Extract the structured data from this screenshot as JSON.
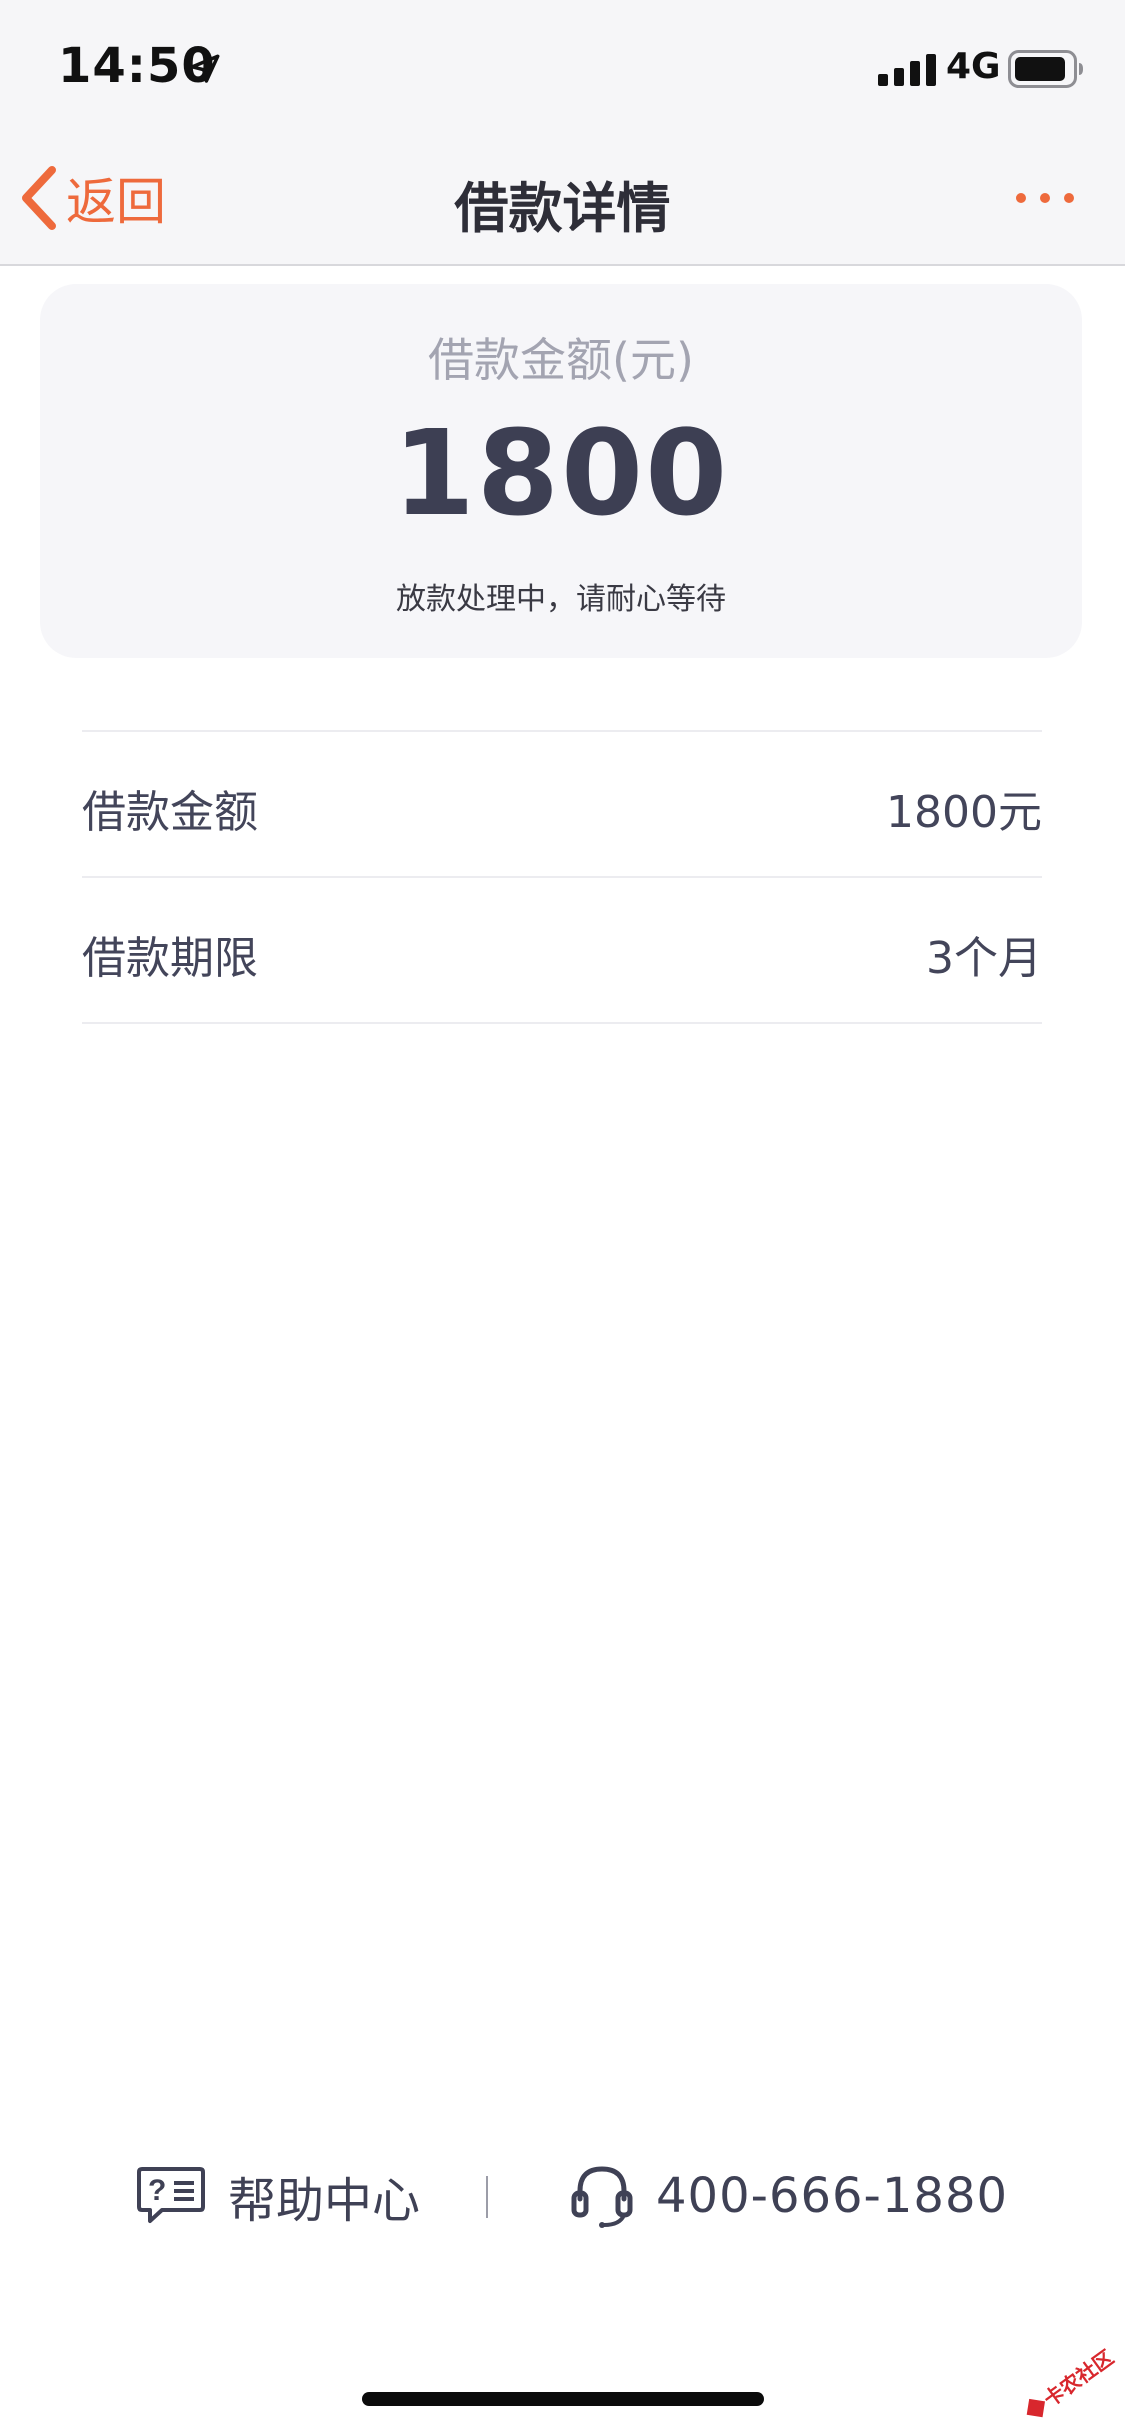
{
  "status_bar": {
    "time": "14:50",
    "network": "4G",
    "icons": [
      "location-arrow-icon",
      "signal-bars-icon",
      "battery-icon"
    ]
  },
  "nav": {
    "back_label": "返回",
    "title": "借款详情",
    "more_icon": "more-dots-icon",
    "accent_color": "#ee6a3c"
  },
  "amount_card": {
    "label": "借款金额(元)",
    "amount": "1800",
    "status": "放款处理中，请耐心等待"
  },
  "details": [
    {
      "label": "借款金额",
      "value": "1800元"
    },
    {
      "label": "借款期限",
      "value": "3个月"
    }
  ],
  "footer": {
    "help_label": "帮助中心",
    "help_icon": "help-chat-icon",
    "phone": "400-666-1880",
    "phone_icon": "headset-icon"
  },
  "watermark": {
    "text": "卡农社区"
  },
  "colors": {
    "text_dark": "#3d3f53",
    "text_muted": "#a3a4b1",
    "divider": "#ececf0",
    "card_bg": "#f6f6f9"
  }
}
